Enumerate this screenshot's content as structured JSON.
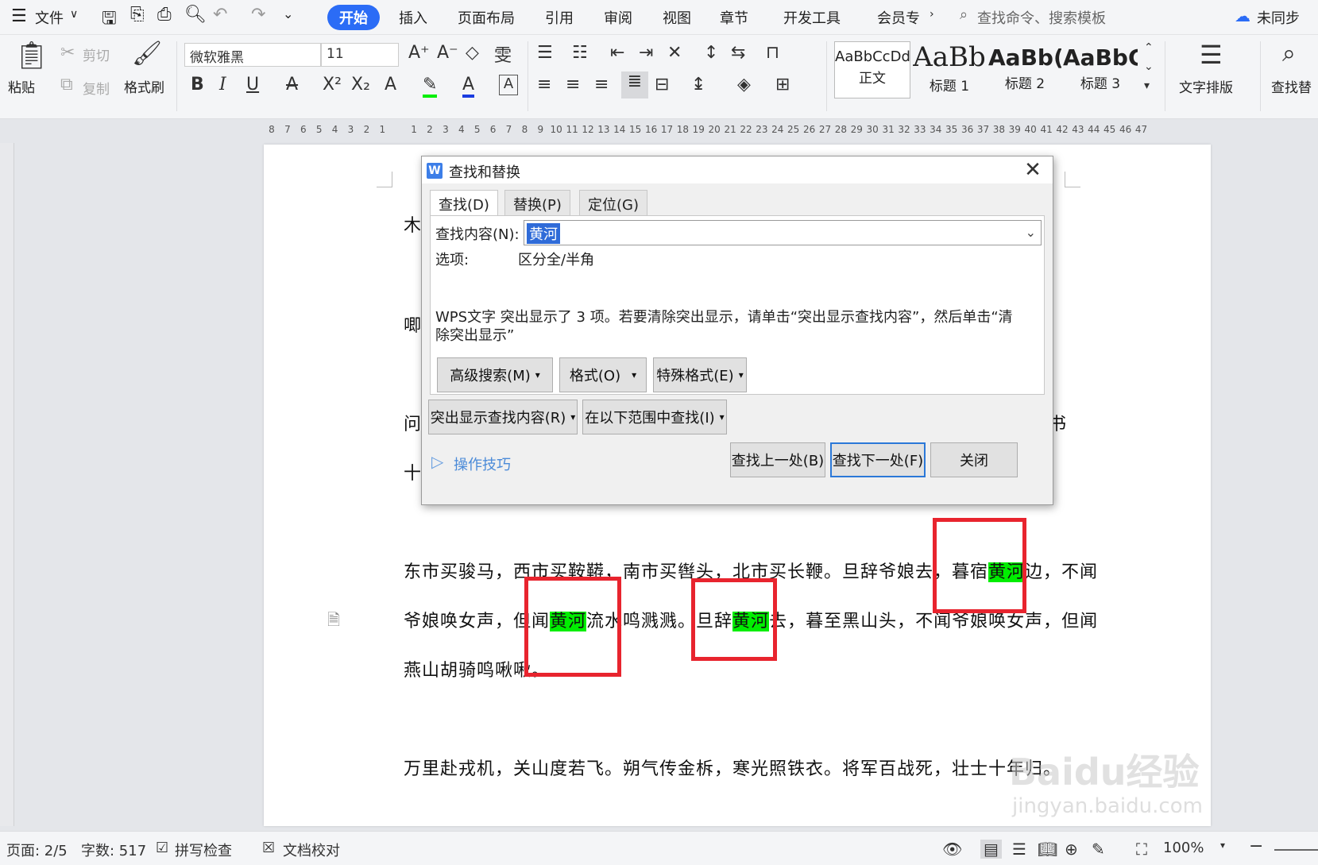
{
  "menubar": {
    "file_menu": "文件",
    "tabs": [
      "开始",
      "插入",
      "页面布局",
      "引用",
      "审阅",
      "视图",
      "章节",
      "开发工具",
      "会员专"
    ],
    "search_placeholder": "查找命令、搜索模板",
    "sync_status": "未同步"
  },
  "ribbon": {
    "paste": "粘贴",
    "cut": "剪切",
    "copy": "复制",
    "format_painter": "格式刷",
    "font_name": "微软雅黑",
    "font_size": "11",
    "styles": [
      {
        "sample": "AaBbCcDd",
        "name": "正文"
      },
      {
        "sample": "AaBb",
        "name": "标题 1"
      },
      {
        "sample": "AaBb(",
        "name": "标题 2"
      },
      {
        "sample": "AaBbC",
        "name": "标题 3"
      }
    ],
    "text_layout": "文字排版",
    "find_replace": "查找替"
  },
  "ruler": {
    "labels": [
      "8",
      "7",
      "6",
      "5",
      "4",
      "3",
      "2",
      "1",
      "",
      "1",
      "2",
      "3",
      "4",
      "5",
      "6",
      "7",
      "8",
      "9",
      "10",
      "11",
      "12",
      "13",
      "14",
      "15",
      "16",
      "17",
      "18",
      "19",
      "20",
      "21",
      "22",
      "23",
      "24",
      "25",
      "26",
      "27",
      "28",
      "29",
      "30",
      "31",
      "32",
      "33",
      "34",
      "35",
      "36",
      "37",
      "38",
      "39",
      "40",
      "41",
      "42",
      "43",
      "44",
      "45",
      "46",
      "47"
    ]
  },
  "document": {
    "fragments": {
      "line1_start": "木",
      "line2_start": "唧",
      "line3_start": "问",
      "line3_end": "书",
      "line4_start": "十"
    },
    "para1": {
      "l1_a": "东市买骏马，西市买鞍鞯，南市买辔头，北市买长鞭。旦辞爷娘去，暮宿",
      "l1_hl": "黄河",
      "l1_b": "边，不闻",
      "l2_a": "爷娘唤女声，但闻",
      "l2_hl1": "黄河",
      "l2_b": "流水鸣溅溅。旦辞",
      "l2_hl2": "黄河",
      "l2_c": "去，暮至黑山头，不闻爷娘唤女声，但闻",
      "l3": "燕山胡骑鸣啾啾。"
    },
    "para2": "万里赴戎机，关山度若飞。朔气传金柝，寒光照铁衣。将军百战死，壮士十年归。"
  },
  "dialog": {
    "title": "查找和替换",
    "tabs": [
      "查找(D)",
      "替换(P)",
      "定位(G)"
    ],
    "find_label": "查找内容(N):",
    "find_value": "黄河",
    "options_label": "选项:",
    "options_value": "区分全/半角",
    "message": "WPS文字 突出显示了 3 项。若要清除突出显示，请单击“突出显示查找内容”，然后单击“清除突出显示”",
    "btn_advanced": "高级搜索(M)",
    "btn_format": "格式(O)",
    "btn_special": "特殊格式(E)",
    "btn_highlight": "突出显示查找内容(R)",
    "btn_scope": "在以下范围中查找(I)",
    "tips_link": "操作技巧",
    "btn_prev": "查找上一处(B)",
    "btn_next": "查找下一处(F)",
    "btn_close": "关闭"
  },
  "statusbar": {
    "page": "页面: 2/5",
    "words": "字数: 517",
    "spellcheck": "拼写检查",
    "doc_check": "文档校对",
    "zoom": "100%"
  },
  "watermark": {
    "text": "Baidu经验",
    "url": "jingyan.baidu.com"
  },
  "colors": {
    "accent": "#2b6cf6",
    "highlight": "#00ee00",
    "annotation_box": "#e8242e"
  }
}
